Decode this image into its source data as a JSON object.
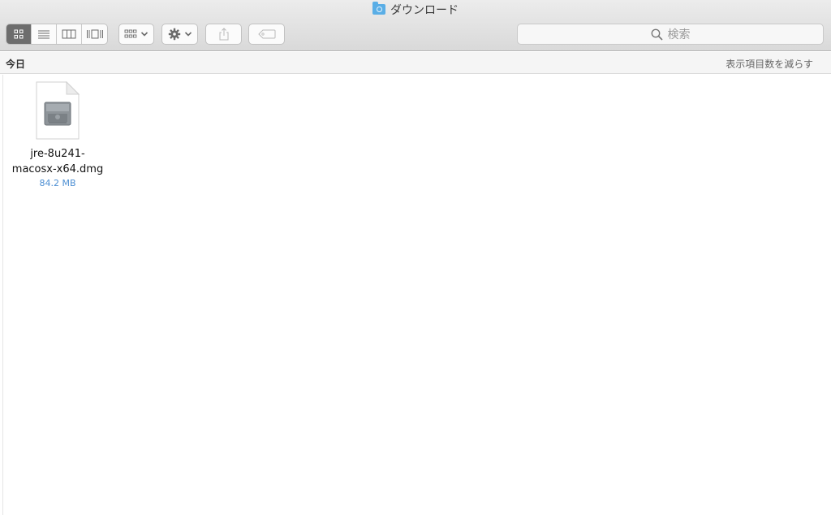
{
  "window": {
    "title": "ダウンロード",
    "folder_icon": "downloads-folder-icon"
  },
  "toolbar": {
    "view_modes": [
      {
        "name": "icon-view-icon",
        "active": true
      },
      {
        "name": "list-view-icon",
        "active": false
      },
      {
        "name": "column-view-icon",
        "active": false
      },
      {
        "name": "coverflow-view-icon",
        "active": false
      }
    ],
    "arrange_icon": "arrange-grid-icon",
    "action_icon": "gear-icon",
    "share_icon": "share-icon",
    "tag_icon": "tag-icon",
    "search": {
      "placeholder": "検索",
      "icon": "search-icon"
    }
  },
  "group": {
    "label": "今日",
    "action": "表示項目数を減らす"
  },
  "files": [
    {
      "name_line1": "jre-8u241-",
      "name_line2": "macosx-x64.dmg",
      "size": "84.2 MB",
      "icon": "disk-image-file-icon"
    }
  ],
  "colors": {
    "accent": "#4d8fd3",
    "active_segment": "#6d6d6d",
    "folder": "#5aaee6"
  }
}
